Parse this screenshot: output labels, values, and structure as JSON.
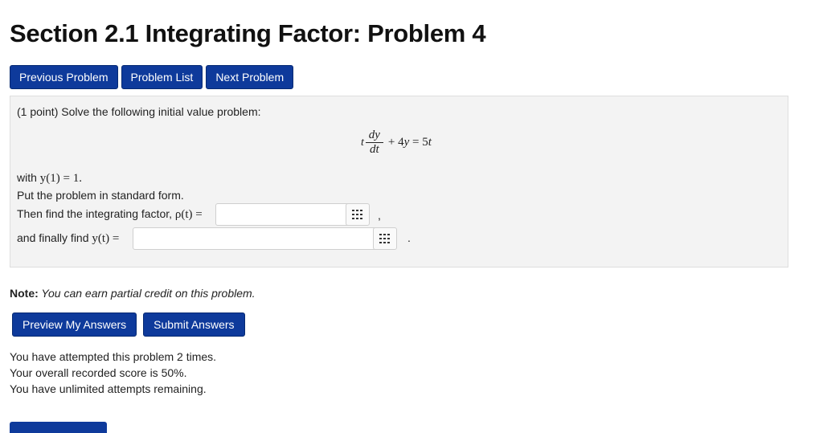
{
  "page": {
    "title": "Section 2.1 Integrating Factor: Problem 4"
  },
  "nav": {
    "previous_label": "Previous Problem",
    "list_label": "Problem List",
    "next_label": "Next Problem"
  },
  "problem": {
    "intro": "(1 point) Solve the following initial value problem:",
    "equation": {
      "lhs_t": "t",
      "numerator": "dy",
      "denominator": "dt",
      "rest_plus": "+ 4",
      "rest_y": "y",
      "rest_eq": " = 5",
      "rest_t": "t"
    },
    "with_prefix": "with ",
    "condition": "y(1) = 1.",
    "standard_form": "Put the problem in standard form.",
    "integrating_prompt": "Then find the integrating factor, ",
    "integrating_math": "ρ(t) =",
    "integrating_value": "",
    "integrating_after": ",",
    "final_prompt": "and finally find ",
    "final_math": "y(t) =",
    "final_value": "",
    "final_after": ".",
    "grid_icon": "equation-editor-grid-icon"
  },
  "note": {
    "label": "Note:",
    "text": " You can earn partial credit on this problem."
  },
  "actions": {
    "preview_label": "Preview My Answers",
    "submit_label": "Submit Answers"
  },
  "status": {
    "attempts": "You have attempted this problem 2 times.",
    "score": "Your overall recorded score is 50%.",
    "remaining": "You have unlimited attempts remaining."
  },
  "colors": {
    "button_bg": "#0e3a9b",
    "panel_bg": "#f3f3f3"
  }
}
